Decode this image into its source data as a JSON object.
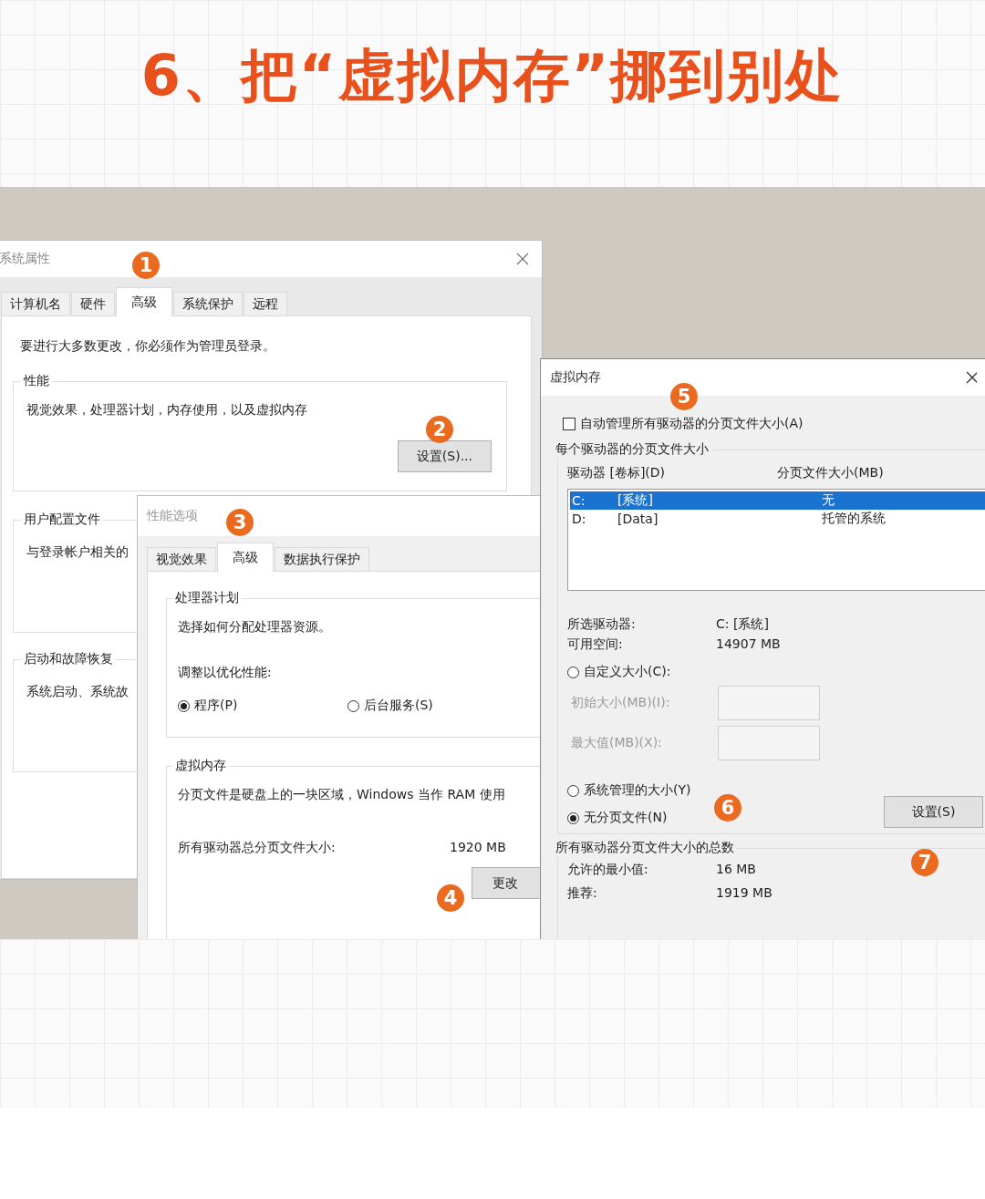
{
  "heading": "6、把“虚拟内存”挪到别处",
  "system_properties": {
    "title": "系统属性",
    "tabs": [
      {
        "label": "计算机名",
        "selected": false
      },
      {
        "label": "硬件",
        "selected": false
      },
      {
        "label": "高级",
        "selected": true
      },
      {
        "label": "系统保护",
        "selected": false
      },
      {
        "label": "远程",
        "selected": false
      }
    ],
    "notice": "要进行大多数更改，你必须作为管理员登录。",
    "groups": [
      {
        "legend": "性能",
        "text": "视觉效果，处理器计划，内存使用，以及虚拟内存",
        "button": "设置(S)..."
      },
      {
        "legend": "用户配置文件",
        "text": "与登录帐户相关的"
      },
      {
        "legend": "启动和故障恢复",
        "text": "系统启动、系统故"
      }
    ]
  },
  "performance_options": {
    "title": "性能选项",
    "tabs": [
      {
        "label": "视觉效果",
        "selected": false
      },
      {
        "label": "高级",
        "selected": true
      },
      {
        "label": "数据执行保护",
        "selected": false
      }
    ],
    "processor": {
      "legend": "处理器计划",
      "text": "选择如何分配处理器资源。",
      "prompt": "调整以优化性能:",
      "options": [
        {
          "label": "程序(P)",
          "selected": true
        },
        {
          "label": "后台服务(S)",
          "selected": false
        }
      ]
    },
    "memory": {
      "legend": "虚拟内存",
      "text": "分页文件是硬盘上的一块区域，Windows 当作 RAM 使用",
      "total_label": "所有驱动器总分页文件大小:",
      "total_value": "1920 MB",
      "button": "更改"
    }
  },
  "virtual_memory": {
    "title": "虚拟内存",
    "auto_manage": {
      "label": "自动管理所有驱动器的分页文件大小(A)",
      "checked": false
    },
    "per_drive": {
      "legend": "每个驱动器的分页文件大小",
      "columns": [
        "驱动器 [卷标](D)",
        "分页文件大小(MB)"
      ],
      "drives": [
        {
          "drive": "C:",
          "label": "[系统]",
          "size": "无",
          "selected": true
        },
        {
          "drive": "D:",
          "label": "[Data]",
          "size": "托管的系统",
          "selected": false
        }
      ],
      "selected_drive_label": "所选驱动器:",
      "selected_drive": "C:  [系统]",
      "free_space_label": "可用空间:",
      "free_space": "14907 MB",
      "options": [
        {
          "kind": "custom",
          "label": "自定义大小(C):",
          "selected": false
        },
        {
          "kind": "system",
          "label": "系统管理的大小(Y)",
          "selected": false
        },
        {
          "kind": "none",
          "label": "无分页文件(N)",
          "selected": true
        }
      ],
      "fields": [
        {
          "label": "初始大小(MB)(I):",
          "disabled": true
        },
        {
          "label": "最大值(MB)(X):",
          "disabled": true
        }
      ],
      "button": "设置(S)"
    },
    "totals": {
      "legend": "所有驱动器分页文件大小的总数",
      "rows": [
        {
          "label": "允许的最小值:",
          "value": "16 MB"
        },
        {
          "label": "推荐:",
          "value": "1919 MB"
        }
      ]
    }
  },
  "steps": [
    "1",
    "2",
    "3",
    "4",
    "5",
    "6",
    "7"
  ]
}
